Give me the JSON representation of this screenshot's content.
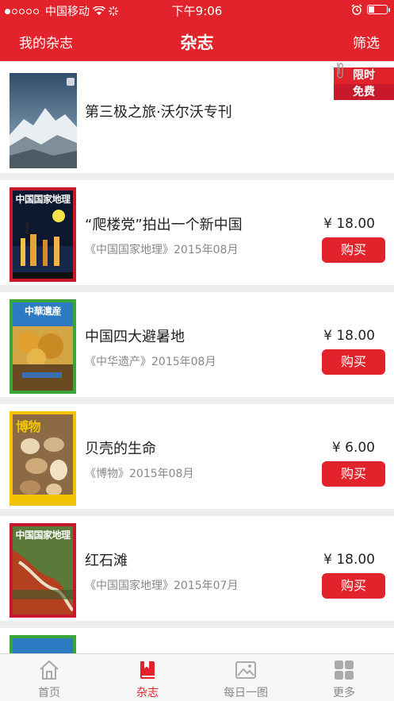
{
  "status_bar": {
    "carrier": "中国移动",
    "time": "下午9:06"
  },
  "header": {
    "left_label": "我的杂志",
    "title": "杂志",
    "right_label": "筛选"
  },
  "ribbon": {
    "line1": "限时",
    "line2": "免费"
  },
  "items": [
    {
      "title": "第三极之旅·沃尔沃专刊",
      "subtitle": "",
      "price": "",
      "buy_label": "",
      "cover_title": "",
      "cover_color": "#3a5a7a",
      "border_color": "#ffffff"
    },
    {
      "title": "“爬楼党”拍出一个新中国",
      "subtitle": "《中国国家地理》2015年08月",
      "price": "¥ 18.00",
      "buy_label": "购买",
      "cover_title": "中国国家地理",
      "cover_color": "#0c1830",
      "border_color": "#c8192a"
    },
    {
      "title": "中国四大避暑地",
      "subtitle": "《中华遗产》2015年08月",
      "price": "¥ 18.00",
      "buy_label": "购买",
      "cover_title": "中華遺産",
      "cover_color": "#b37d2a",
      "border_color": "#3aa63a"
    },
    {
      "title": "贝壳的生命",
      "subtitle": "《博物》2015年08月",
      "price": "¥ 6.00",
      "buy_label": "购买",
      "cover_title": "博物",
      "cover_color": "#8b6a45",
      "border_color": "#f2c500"
    },
    {
      "title": "红石滩",
      "subtitle": "《中国国家地理》2015年07月",
      "price": "¥ 18.00",
      "buy_label": "购买",
      "cover_title": "中国国家地理",
      "cover_color": "#7a3a2a",
      "border_color": "#c8192a"
    }
  ],
  "tabs": [
    {
      "label": "首页",
      "icon": "home-icon",
      "active": false
    },
    {
      "label": "杂志",
      "icon": "book-icon",
      "active": true
    },
    {
      "label": "每日一图",
      "icon": "image-icon",
      "active": false
    },
    {
      "label": "更多",
      "icon": "grid-icon",
      "active": false
    }
  ],
  "colors": {
    "accent": "#e3232b",
    "background": "#eeeeee"
  }
}
